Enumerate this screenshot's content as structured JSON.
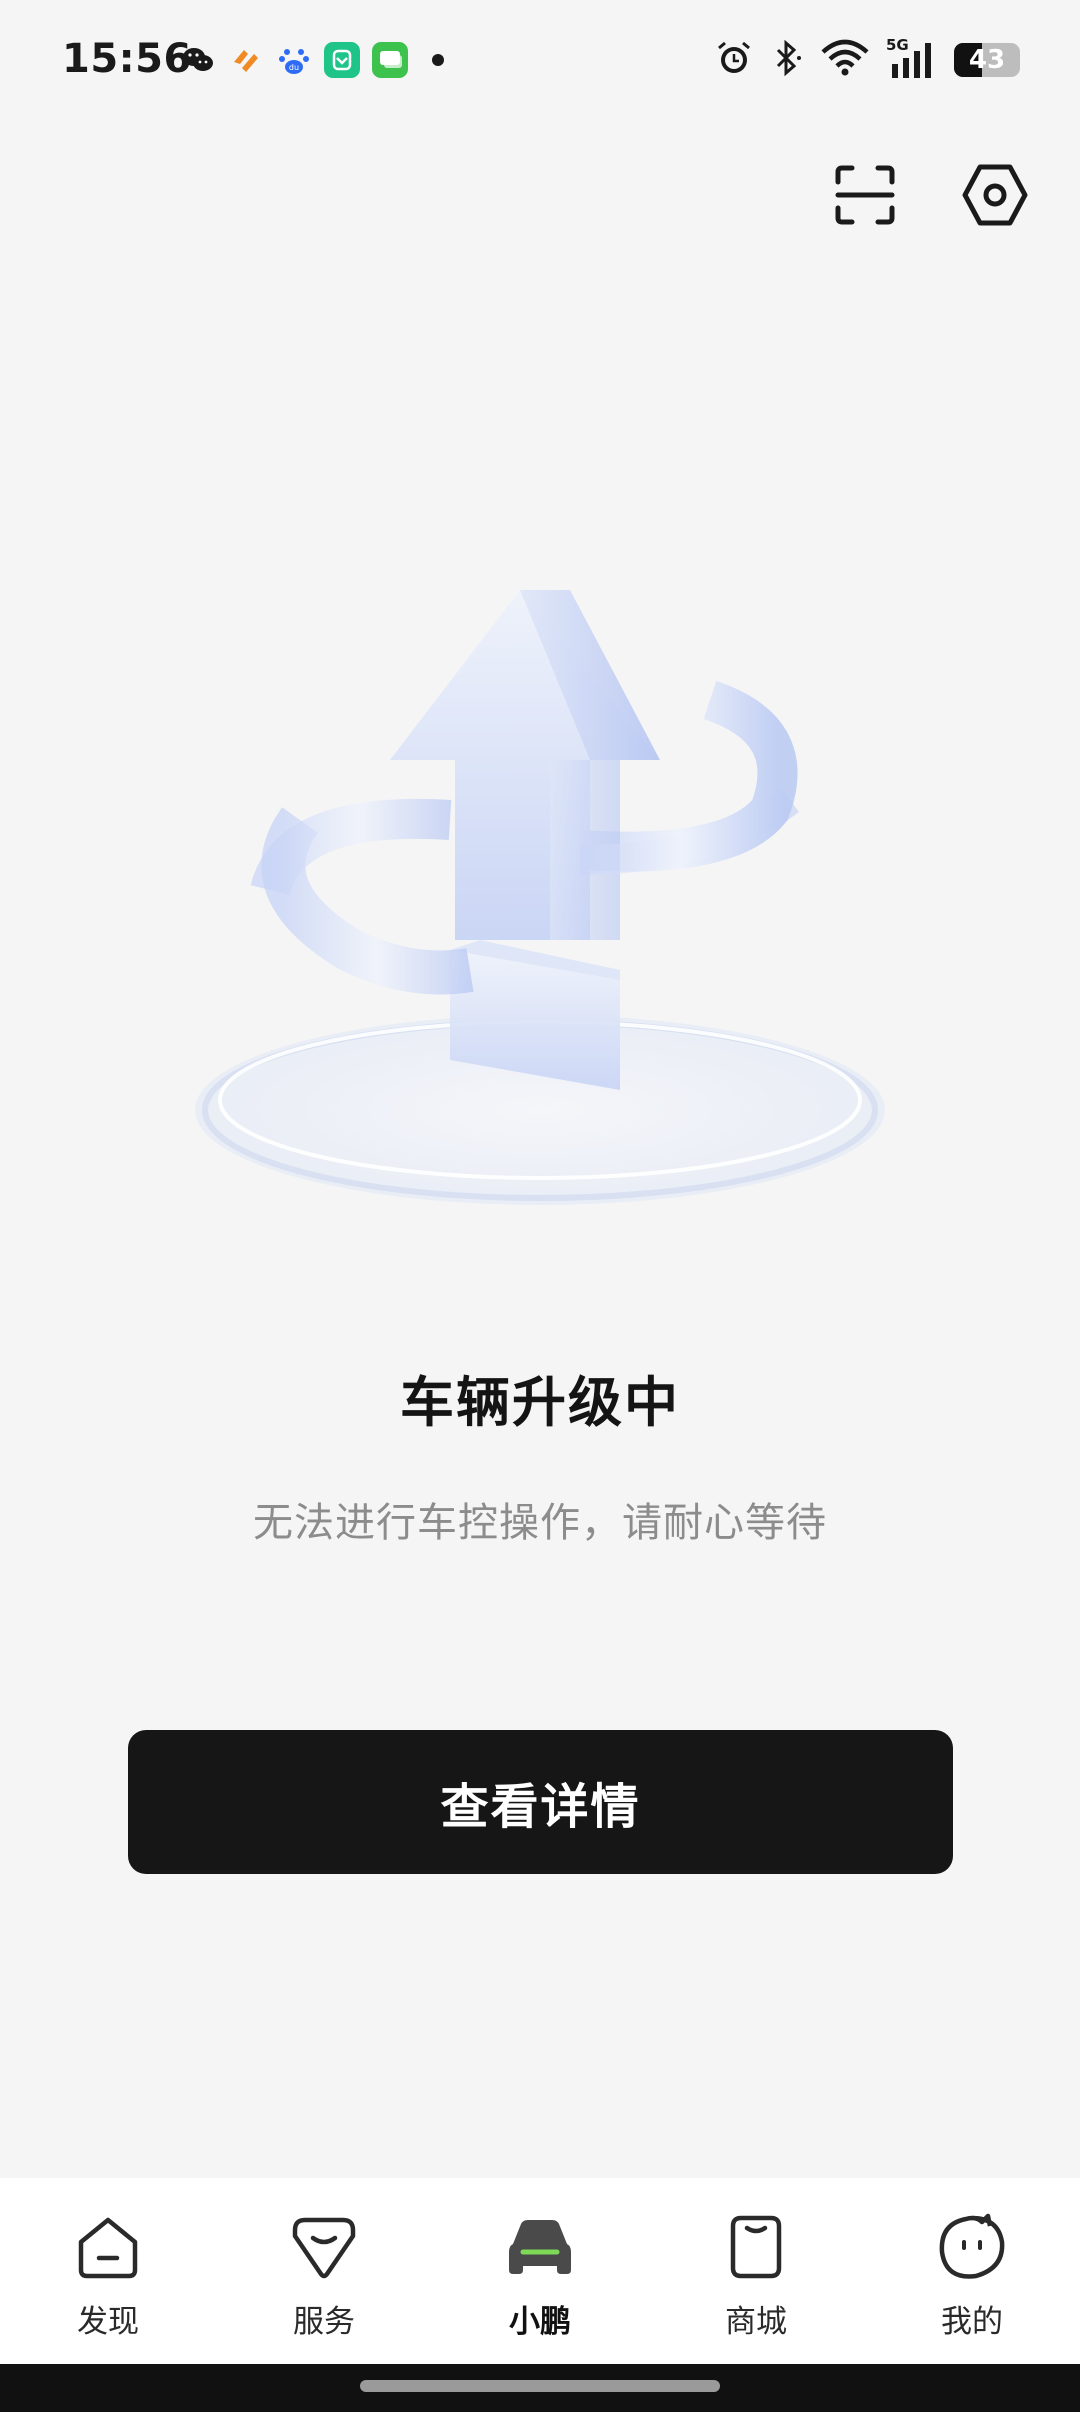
{
  "status_bar": {
    "time": "15:56",
    "battery_level": "43",
    "battery_fraction": 0.43,
    "network": "5G",
    "left_icons": [
      "wechat-icon",
      "orange-app-icon",
      "baidu-icon",
      "green-mi-app-icon",
      "green-chat-app-icon",
      "notification-dot-icon"
    ],
    "right_icons": [
      "alarm-icon",
      "bluetooth-icon",
      "wifi-icon",
      "cellular-5g-icon",
      "battery-icon"
    ]
  },
  "header": {
    "scan_icon": "scan-icon",
    "settings_icon": "settings-hexagon-icon"
  },
  "main": {
    "illustration": "upgrade-arrow-illustration",
    "title": "车辆升级中",
    "subtitle": "无法进行车控操作，请耐心等待",
    "primary_button": "查看详情"
  },
  "bottom_nav": {
    "items": [
      {
        "label": "发现",
        "icon": "home-icon",
        "active": false
      },
      {
        "label": "服务",
        "icon": "service-icon",
        "active": false
      },
      {
        "label": "小鹏",
        "icon": "car-icon",
        "active": true
      },
      {
        "label": "商城",
        "icon": "shopping-bag-icon",
        "active": false
      },
      {
        "label": "我的",
        "icon": "profile-face-icon",
        "active": false
      }
    ]
  },
  "colors": {
    "background": "#f5f5f5",
    "primary_button": "#161616",
    "accent_green": "#7ed957",
    "muted_text": "#8c8c8c"
  }
}
